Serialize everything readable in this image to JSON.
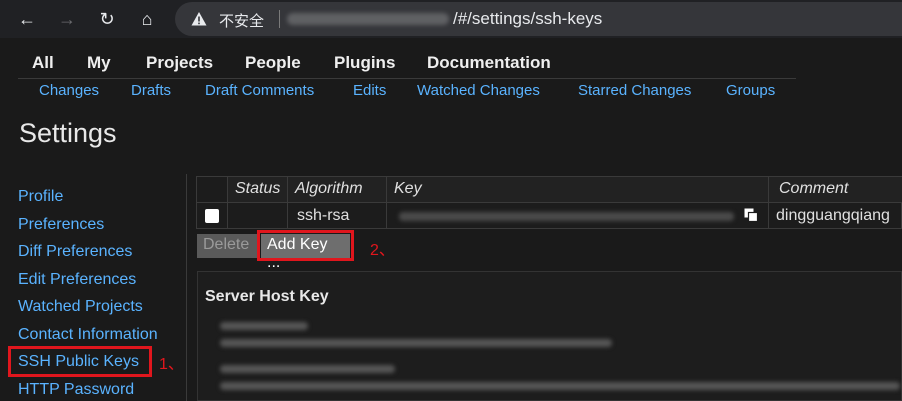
{
  "browser": {
    "back": "←",
    "forward": "→",
    "reload": "↻",
    "home": "⌂",
    "security_label": "不安全",
    "path": "/#/settings/ssh-keys"
  },
  "topnav": [
    "All",
    "My",
    "Projects",
    "People",
    "Plugins",
    "Documentation"
  ],
  "subnav": [
    "Changes",
    "Drafts",
    "Draft Comments",
    "Edits",
    "Watched Changes",
    "Starred Changes",
    "Groups"
  ],
  "page_title": "Settings",
  "sidebar": [
    "Profile",
    "Preferences",
    "Diff Preferences",
    "Edit Preferences",
    "Watched Projects",
    "Contact Information",
    "SSH Public Keys",
    "HTTP Password"
  ],
  "annotations": {
    "step1": "1、",
    "step2": "2、"
  },
  "table": {
    "headers": [
      "Status",
      "Algorithm",
      "Key",
      "Comment"
    ],
    "rows": [
      {
        "algorithm": "ssh-rsa",
        "comment": "dingguangqiang"
      }
    ]
  },
  "buttons": {
    "delete": "Delete",
    "add_key": "Add Key ..."
  },
  "host_key": {
    "title": "Server Host Key"
  },
  "colors": {
    "link": "#5ab3ff",
    "highlight": "#e0161d"
  }
}
